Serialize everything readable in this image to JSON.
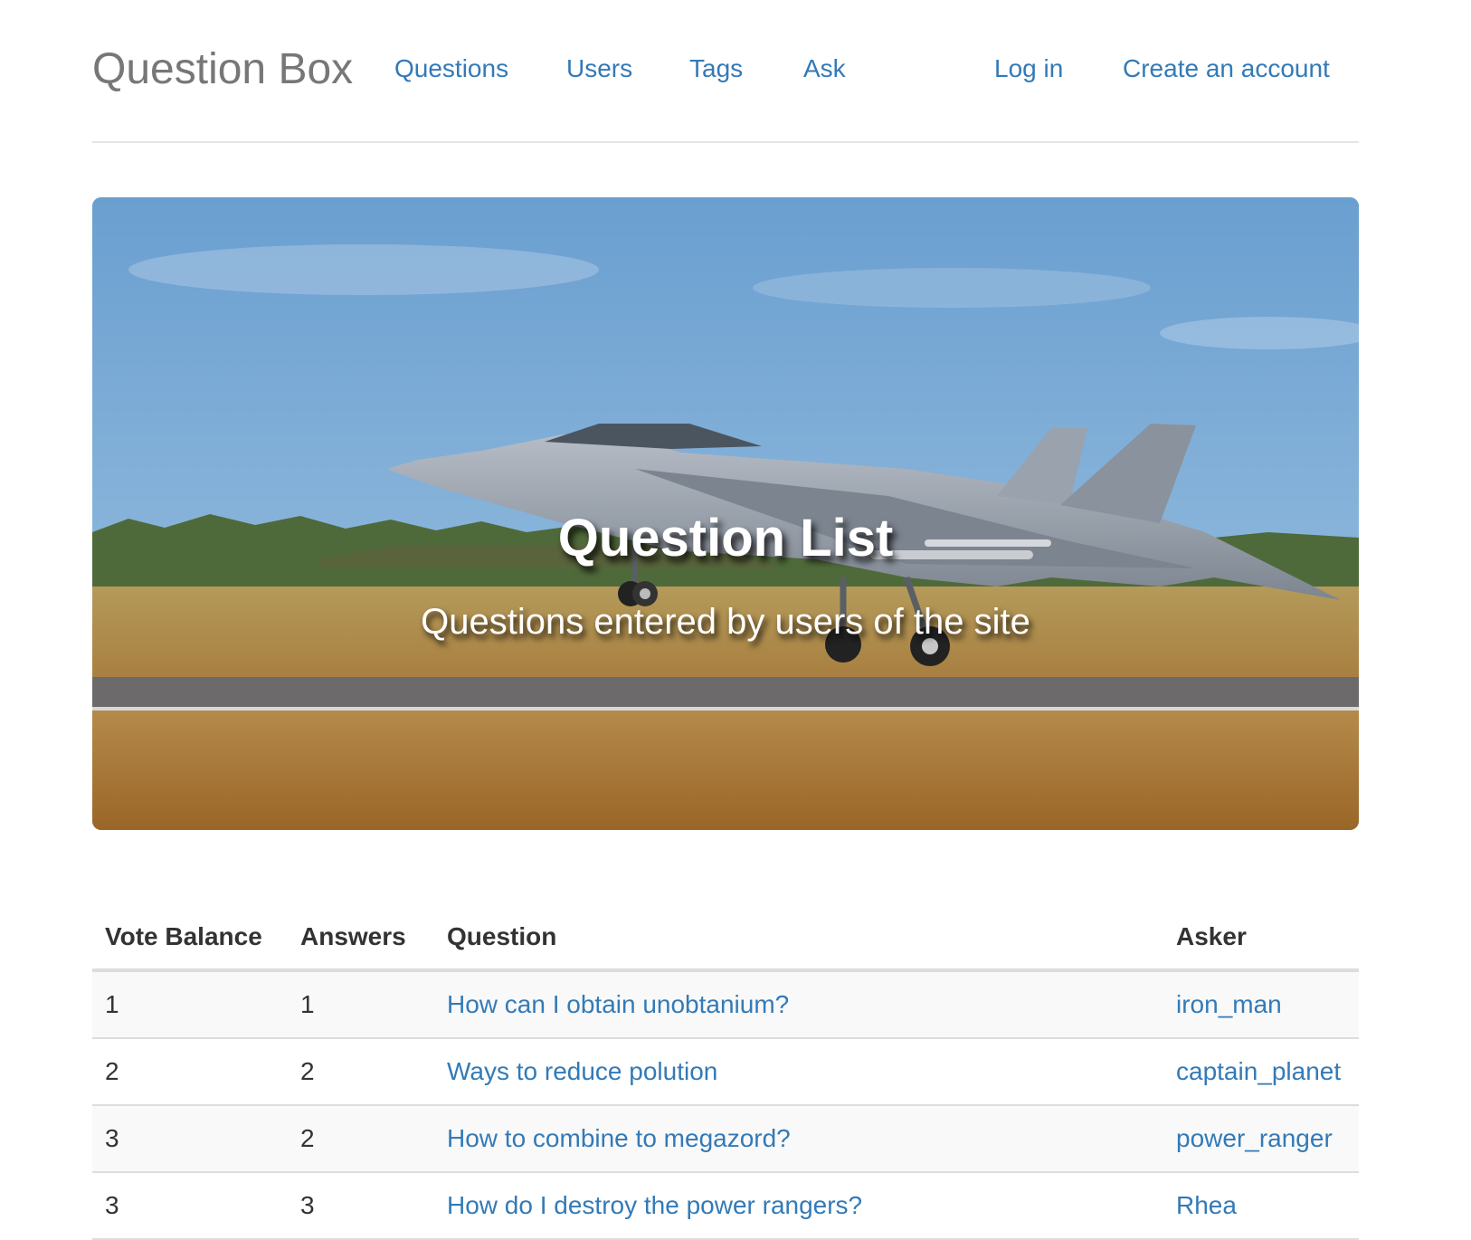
{
  "navbar": {
    "brand": "Question Box",
    "links": {
      "questions": "Questions",
      "users": "Users",
      "tags": "Tags",
      "ask": "Ask",
      "login": "Log in",
      "signup": "Create an account"
    }
  },
  "hero": {
    "title": "Question List",
    "subtitle": "Questions entered by users of the site",
    "image": "fighter-jet-on-runway"
  },
  "table": {
    "headers": {
      "vote": "Vote Balance",
      "answers": "Answers",
      "question": "Question",
      "asker": "Asker"
    },
    "rows": [
      {
        "vote": "1",
        "answers": "1",
        "question": "How can I obtain unobtanium?",
        "asker": "iron_man"
      },
      {
        "vote": "2",
        "answers": "2",
        "question": "Ways to reduce polution",
        "asker": "captain_planet"
      },
      {
        "vote": "3",
        "answers": "2",
        "question": "How to combine to megazord?",
        "asker": "power_ranger"
      },
      {
        "vote": "3",
        "answers": "3",
        "question": "How do I destroy the power rangers?",
        "asker": "Rhea"
      }
    ]
  },
  "colors": {
    "link": "#337ab7",
    "brand": "#777777",
    "text": "#333333",
    "stripe": "#f9f9f9",
    "border": "#dddddd"
  }
}
